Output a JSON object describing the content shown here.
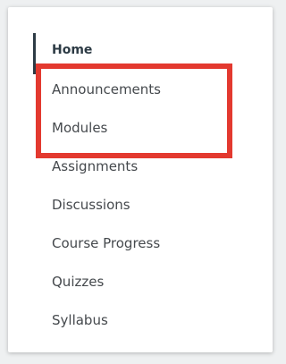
{
  "course_nav": {
    "items": [
      {
        "label": "Home",
        "active": true
      },
      {
        "label": "Announcements",
        "active": false
      },
      {
        "label": "Modules",
        "active": false
      },
      {
        "label": "Assignments",
        "active": false
      },
      {
        "label": "Discussions",
        "active": false
      },
      {
        "label": "Course Progress",
        "active": false
      },
      {
        "label": "Quizzes",
        "active": false
      },
      {
        "label": "Syllabus",
        "active": false
      }
    ]
  },
  "colors": {
    "highlight": "#e3392f",
    "active_indicator": "#2d3b45",
    "text": "#45494d"
  }
}
